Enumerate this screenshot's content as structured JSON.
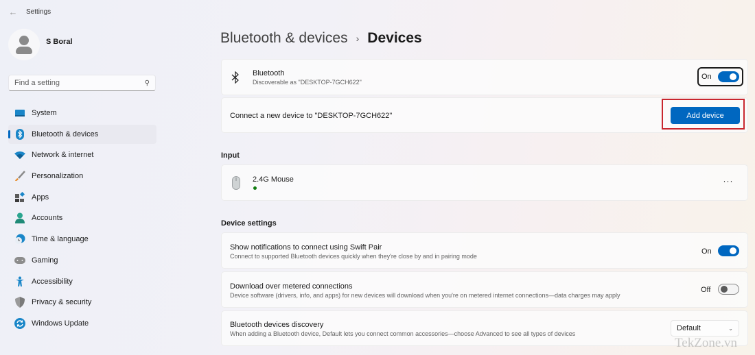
{
  "window": {
    "title": "Settings"
  },
  "profile": {
    "name": "S Boral"
  },
  "search": {
    "placeholder": "Find a setting"
  },
  "sidebar": {
    "items": [
      {
        "label": "System",
        "icon": "system-icon",
        "active": false
      },
      {
        "label": "Bluetooth & devices",
        "icon": "bluetooth-icon",
        "active": true
      },
      {
        "label": "Network & internet",
        "icon": "wifi-icon",
        "active": false
      },
      {
        "label": "Personalization",
        "icon": "brush-icon",
        "active": false
      },
      {
        "label": "Apps",
        "icon": "apps-icon",
        "active": false
      },
      {
        "label": "Accounts",
        "icon": "accounts-icon",
        "active": false
      },
      {
        "label": "Time & language",
        "icon": "clock-globe-icon",
        "active": false
      },
      {
        "label": "Gaming",
        "icon": "gamepad-icon",
        "active": false
      },
      {
        "label": "Accessibility",
        "icon": "accessibility-icon",
        "active": false
      },
      {
        "label": "Privacy & security",
        "icon": "shield-icon",
        "active": false
      },
      {
        "label": "Windows Update",
        "icon": "update-icon",
        "active": false
      }
    ]
  },
  "breadcrumb": {
    "parent": "Bluetooth & devices",
    "separator": "›",
    "current": "Devices"
  },
  "bluetooth_card": {
    "title": "Bluetooth",
    "subtitle": "Discoverable as \"DESKTOP-7GCH622\"",
    "toggle_label": "On",
    "toggle_on": true
  },
  "connect_card": {
    "text": "Connect a new device to \"DESKTOP-7GCH622\"",
    "button_label": "Add device"
  },
  "input_section": {
    "title": "Input",
    "devices": [
      {
        "name": "2.4G Mouse",
        "status_color": "#107c10",
        "more_label": "···"
      }
    ]
  },
  "device_settings": {
    "title": "Device settings",
    "items": [
      {
        "title": "Show notifications to connect using Swift Pair",
        "subtitle": "Connect to supported Bluetooth devices quickly when they're close by and in pairing mode",
        "control": "toggle",
        "toggle_label": "On",
        "toggle_on": true
      },
      {
        "title": "Download over metered connections",
        "subtitle": "Device software (drivers, info, and apps) for new devices will download when you're on metered internet connections—data charges may apply",
        "control": "toggle",
        "toggle_label": "Off",
        "toggle_on": false
      },
      {
        "title": "Bluetooth devices discovery",
        "subtitle": "When adding a Bluetooth device, Default lets you connect common accessories—choose Advanced to see all types of devices",
        "control": "dropdown",
        "selected": "Default"
      }
    ]
  },
  "colors": {
    "accent": "#0067c0",
    "highlight_box": "#c8262e"
  },
  "watermark": "TekZone.vn"
}
